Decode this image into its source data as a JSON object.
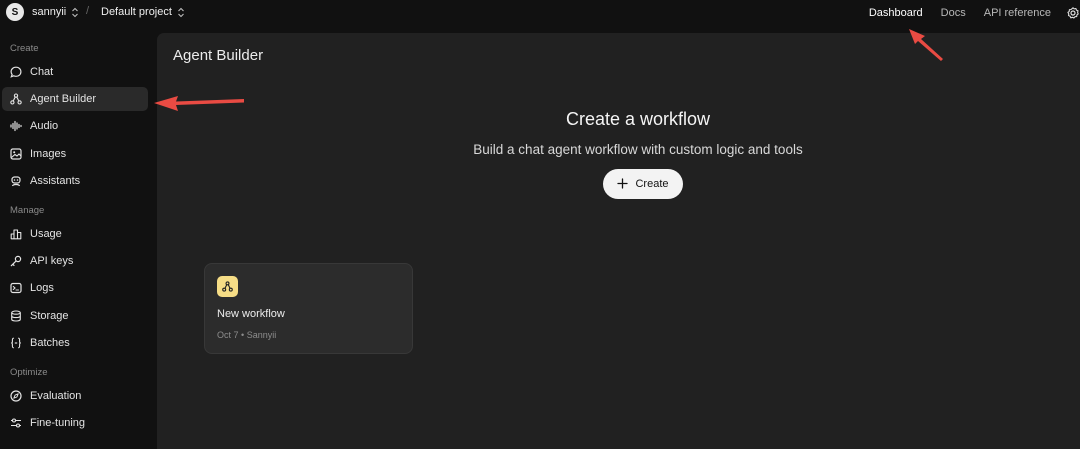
{
  "topbar": {
    "org_initial": "S",
    "org_name": "sannyii",
    "separator": "/",
    "project_name": "Default project",
    "nav": [
      {
        "label": "Dashboard",
        "active": true
      },
      {
        "label": "Docs",
        "active": false
      },
      {
        "label": "API reference",
        "active": false
      }
    ],
    "settings_icon": "gear-icon"
  },
  "sidebar": {
    "sections": [
      {
        "label": "Create",
        "items": [
          {
            "label": "Chat",
            "icon": "chat-bubble-icon"
          },
          {
            "label": "Agent Builder",
            "icon": "workflow-icon",
            "active": true
          },
          {
            "label": "Audio",
            "icon": "waveform-icon"
          },
          {
            "label": "Images",
            "icon": "image-icon"
          },
          {
            "label": "Assistants",
            "icon": "robot-icon"
          }
        ]
      },
      {
        "label": "Manage",
        "items": [
          {
            "label": "Usage",
            "icon": "bar-chart-icon"
          },
          {
            "label": "API keys",
            "icon": "key-icon"
          },
          {
            "label": "Logs",
            "icon": "terminal-icon"
          },
          {
            "label": "Storage",
            "icon": "database-icon"
          },
          {
            "label": "Batches",
            "icon": "braces-icon"
          }
        ]
      },
      {
        "label": "Optimize",
        "items": [
          {
            "label": "Evaluation",
            "icon": "compass-icon"
          },
          {
            "label": "Fine-tuning",
            "icon": "sliders-icon"
          }
        ]
      }
    ]
  },
  "main": {
    "page_title": "Agent Builder",
    "hero_title": "Create a workflow",
    "hero_subtitle": "Build a chat agent workflow with custom logic and tools",
    "create_button_label": "Create",
    "workflows": [
      {
        "name": "New workflow",
        "date": "Oct 7",
        "separator": "•",
        "author": "Sannyii",
        "icon": "workflow-icon"
      }
    ]
  },
  "annotations": {
    "arrow_color": "#e94b43"
  },
  "colors": {
    "background": "#111111",
    "panel": "#212121",
    "card": "#2c2c2c",
    "workflow_icon_bg": "#f6dd86",
    "button_bg": "#f3f3f3"
  }
}
